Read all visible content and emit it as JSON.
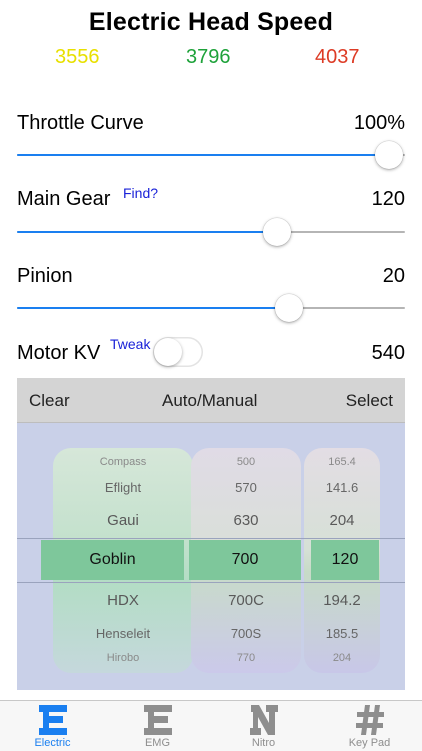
{
  "title": "Electric Head Speed",
  "head_speeds": {
    "low": "3556",
    "mid": "3796",
    "high": "4037"
  },
  "throttle": {
    "label": "Throttle Curve",
    "value": "100%",
    "slider_fraction": 0.96
  },
  "main_gear": {
    "label": "Main Gear",
    "link": "Find?",
    "value": "120",
    "slider_fraction": 0.67
  },
  "pinion": {
    "label": "Pinion",
    "value": "20",
    "slider_fraction": 0.7
  },
  "motor_kv": {
    "label": "Motor KV",
    "link": "Tweak",
    "value": "540",
    "toggle_on": false
  },
  "picker": {
    "clear": "Clear",
    "mode": "Auto/Manual",
    "select": "Select",
    "rows": [
      {
        "brand": "Compass",
        "size": "500",
        "kv": "165.4"
      },
      {
        "brand": "Eflight",
        "size": "570",
        "kv": "141.6"
      },
      {
        "brand": "Gaui",
        "size": "630",
        "kv": "204"
      },
      {
        "brand": "Goblin",
        "size": "700",
        "kv": "120"
      },
      {
        "brand": "HDX",
        "size": "700C",
        "kv": "194.2"
      },
      {
        "brand": "Henseleit",
        "size": "700S",
        "kv": "185.5"
      },
      {
        "brand": "Hirobo",
        "size": "770",
        "kv": "204"
      }
    ]
  },
  "tabs": [
    {
      "label": "Electric",
      "icon": "E",
      "active": true
    },
    {
      "label": "EMG",
      "icon": "E",
      "active": false
    },
    {
      "label": "Nitro",
      "icon": "N",
      "active": false
    },
    {
      "label": "Key Pad",
      "icon": "#",
      "active": false
    }
  ],
  "colors": {
    "accent": "#1a7ff0",
    "low": "#e8e000",
    "mid": "#1ea23a",
    "high": "#dd3b25",
    "selected_row": "#7ec79b"
  }
}
